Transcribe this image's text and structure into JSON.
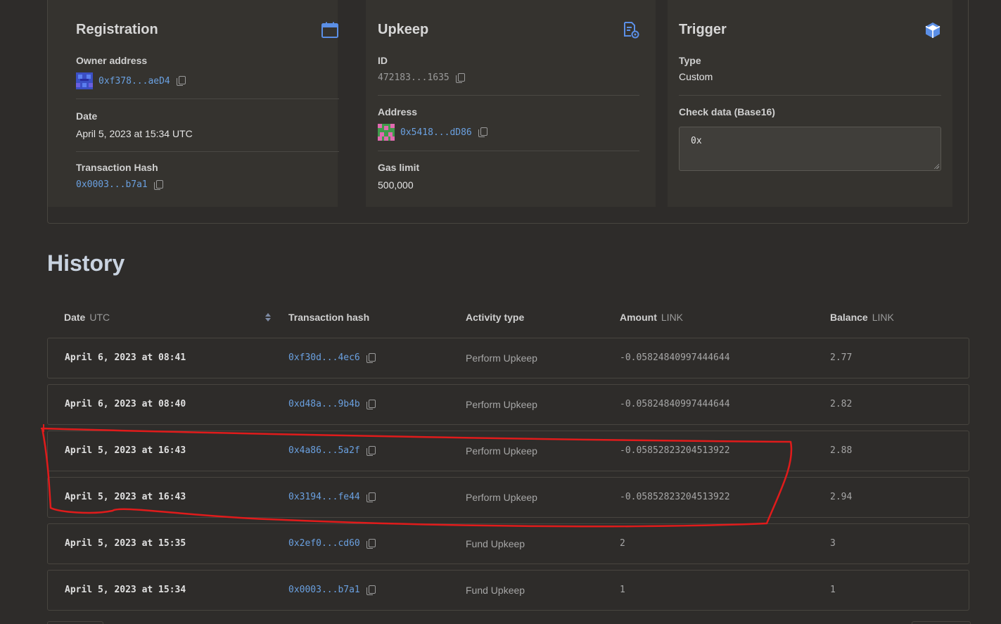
{
  "registration": {
    "title": "Registration",
    "owner_label": "Owner address",
    "owner_value": "0xf378...aeD4",
    "date_label": "Date",
    "date_value": "April 5, 2023 at 15:34 UTC",
    "tx_label": "Transaction Hash",
    "tx_value": "0x0003...b7a1",
    "icon": "calendar-icon"
  },
  "upkeep": {
    "title": "Upkeep",
    "id_label": "ID",
    "id_value": "472183...1635",
    "address_label": "Address",
    "address_value": "0x5418...dD86",
    "gas_label": "Gas limit",
    "gas_value": "500,000",
    "icon": "document-gear-icon"
  },
  "trigger": {
    "title": "Trigger",
    "type_label": "Type",
    "type_value": "Custom",
    "checkdata_label": "Check data (Base16)",
    "checkdata_value": "0x",
    "icon": "cube-icon"
  },
  "history": {
    "title": "History",
    "columns": {
      "date": "Date",
      "date_unit": "UTC",
      "hash": "Transaction hash",
      "activity": "Activity type",
      "amount": "Amount",
      "amount_unit": "LINK",
      "balance": "Balance",
      "balance_unit": "LINK"
    },
    "rows": [
      {
        "date": "April 6, 2023 at 08:41",
        "hash": "0xf30d...4ec6",
        "activity": "Perform Upkeep",
        "amount": "-0.05824840997444644",
        "balance": "2.77"
      },
      {
        "date": "April 6, 2023 at 08:40",
        "hash": "0xd48a...9b4b",
        "activity": "Perform Upkeep",
        "amount": "-0.05824840997444644",
        "balance": "2.82"
      },
      {
        "date": "April 5, 2023 at 16:43",
        "hash": "0x4a86...5a2f",
        "activity": "Perform Upkeep",
        "amount": "-0.05852823204513922",
        "balance": "2.88"
      },
      {
        "date": "April 5, 2023 at 16:43",
        "hash": "0x3194...fe44",
        "activity": "Perform Upkeep",
        "amount": "-0.05852823204513922",
        "balance": "2.94"
      },
      {
        "date": "April 5, 2023 at 15:35",
        "hash": "0x2ef0...cd60",
        "activity": "Fund Upkeep",
        "amount": "2",
        "balance": "3"
      },
      {
        "date": "April 5, 2023 at 15:34",
        "hash": "0x0003...b7a1",
        "activity": "Fund Upkeep",
        "amount": "1",
        "balance": "1"
      }
    ]
  },
  "colors": {
    "background": "#2e2c2a",
    "panel": "#35332f",
    "link": "#6aa0e0",
    "annotation": "#e01b1b"
  }
}
